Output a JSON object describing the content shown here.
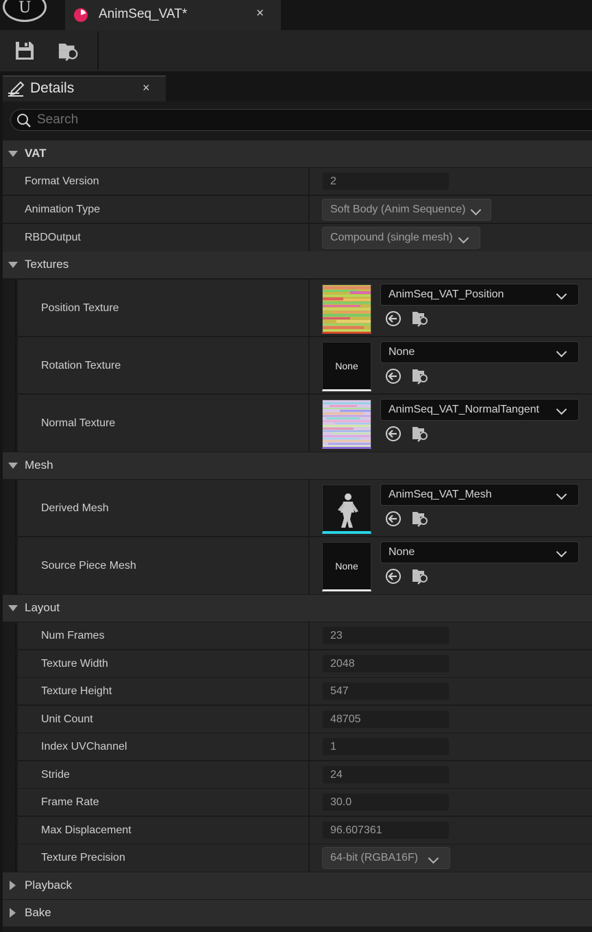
{
  "tab": {
    "title": "AnimSeq_VAT*",
    "close": "×"
  },
  "panel": {
    "title": "Details",
    "close": "×"
  },
  "search": {
    "placeholder": "Search"
  },
  "icons": {
    "logo": "unreal-engine-logo-icon",
    "anim_sequence": "anim-sequence-icon",
    "save": "save-icon",
    "browse": "browse-to-asset-icon",
    "details": "details-panel-icon",
    "search": "search-icon",
    "use_selected": "use-selected-asset-icon"
  },
  "colors": {
    "accent_anim": "#e0245e",
    "skeletal_mesh": "#2ad4e6"
  },
  "sections": {
    "vat": {
      "label": "VAT",
      "format_version": {
        "label": "Format Version",
        "value": "2"
      },
      "animation_type": {
        "label": "Animation Type",
        "value": "Soft Body (Anim Sequence)"
      },
      "rbd_output": {
        "label": "RBDOutput",
        "value": "Compound (single mesh)"
      }
    },
    "textures": {
      "label": "Textures",
      "position": {
        "label": "Position Texture",
        "value": "AnimSeq_VAT_Position"
      },
      "rotation": {
        "label": "Rotation Texture",
        "value": "None",
        "thumb": "None"
      },
      "normal": {
        "label": "Normal Texture",
        "value": "AnimSeq_VAT_NormalTangent"
      }
    },
    "mesh": {
      "label": "Mesh",
      "derived": {
        "label": "Derived Mesh",
        "value": "AnimSeq_VAT_Mesh"
      },
      "source_piece": {
        "label": "Source Piece Mesh",
        "value": "None",
        "thumb": "None"
      }
    },
    "layout": {
      "label": "Layout",
      "num_frames": {
        "label": "Num Frames",
        "value": "23"
      },
      "texture_width": {
        "label": "Texture Width",
        "value": "2048"
      },
      "texture_height": {
        "label": "Texture Height",
        "value": "547"
      },
      "unit_count": {
        "label": "Unit Count",
        "value": "48705"
      },
      "index_uv": {
        "label": "Index UVChannel",
        "value": "1"
      },
      "stride": {
        "label": "Stride",
        "value": "24"
      },
      "frame_rate": {
        "label": "Frame Rate",
        "value": "30.0"
      },
      "max_displacement": {
        "label": "Max Displacement",
        "value": "96.607361"
      },
      "texture_precision": {
        "label": "Texture Precision",
        "value": "64-bit (RGBA16F)"
      }
    },
    "playback": {
      "label": "Playback"
    },
    "bake": {
      "label": "Bake"
    }
  }
}
